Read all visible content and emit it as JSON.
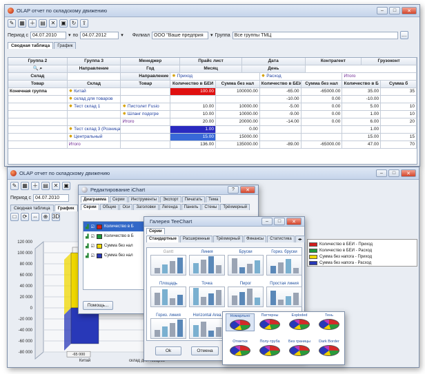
{
  "back_window": {
    "title": "OLAP отчет по складскому движению",
    "filter": {
      "period_from_label": "Период с",
      "period_from": "04.07.2010",
      "period_to_label": "по",
      "period_to": "04.07.2012",
      "branch_label": "Филиал",
      "branch_value": "ООО \"Ваше предприя",
      "group_label": "Группа",
      "group_value": "Все группы ТМЦ"
    },
    "tabs": [
      "Сводная таблица",
      "График"
    ],
    "header_fields": [
      "Группа 2",
      "Группа 3",
      "Менеджер",
      "Прайс лист",
      "Дата",
      "Контрагент",
      "Грузоконт"
    ],
    "header_fields2": [
      "Направление",
      "Год",
      "Месяц",
      "День"
    ],
    "row_fields": [
      "Склад",
      "Товар"
    ],
    "direction_label": "Направление",
    "warehouse_label": "Склад",
    "product_label": "Товар",
    "col_groups": [
      "Приход",
      "Расход",
      "Итого"
    ],
    "measures": [
      "Количество в БЕИ",
      "Сумма без нал",
      "Количество в БЕИ",
      "Сумма без нал",
      "Количество в Б",
      "Сумма б"
    ],
    "group_label_total": "Конечная группа",
    "rows": [
      {
        "wh": "Китай",
        "prod": "",
        "v": [
          "100.00",
          "100000.00",
          "-65.00",
          "-65000.00",
          "35.00",
          "35"
        ]
      },
      {
        "wh": "склад для товаров",
        "prod": "",
        "v": [
          "",
          "",
          "-10.00",
          "0.00",
          "-10.00",
          ""
        ]
      },
      {
        "wh": "Тест склад 1",
        "prod": "Пистолет Fusio",
        "v": [
          "10.00",
          "10000.00",
          "-5.00",
          "0.00",
          "5.00",
          "10"
        ]
      },
      {
        "wh": "",
        "prod": "Шланг подогре",
        "v": [
          "10.00",
          "10000.00",
          "-9.00",
          "0.00",
          "1.00",
          "10"
        ]
      },
      {
        "wh": "",
        "prod": "Итого",
        "v": [
          "20.00",
          "20000.00",
          "-14.00",
          "0.00",
          "6.00",
          "20"
        ]
      },
      {
        "wh": "Тест склад 3 (Розница)",
        "prod": "",
        "v": [
          "1.00",
          "0.00",
          "",
          "",
          "1.00",
          ""
        ]
      },
      {
        "wh": "Центральный",
        "prod": "",
        "v": [
          "15.00",
          "15000.00",
          "",
          "",
          "15.00",
          "15"
        ]
      },
      {
        "wh": "Итого",
        "prod": "",
        "v": [
          "136.00",
          "135000.00",
          "-89.00",
          "-65000.00",
          "47.00",
          "70"
        ]
      }
    ]
  },
  "front_window": {
    "title": "OLAP отчет по складскому движению",
    "period_label": "Период с",
    "period_value": "04.07.2010",
    "tabs": [
      "Сводная таблица",
      "График"
    ],
    "y_ticks": [
      "120 000",
      "100 000",
      "80 000",
      "60 000",
      "40 000",
      "20 000",
      "0",
      "-20 000",
      "-40 000",
      "-60 000",
      "-80 000"
    ],
    "value_top": "100 000",
    "value_bottom": "-65 000",
    "x_labels": [
      "Китай",
      "склад для товаров"
    ]
  },
  "chart_data": {
    "type": "bar",
    "categories": [
      "Китай",
      "склад для товаров"
    ],
    "series": [
      {
        "name": "Количество в БЕИ - Приход",
        "values": [
          100,
          0
        ]
      },
      {
        "name": "Количество в БЕИ - Расход",
        "values": [
          -65,
          -10
        ]
      },
      {
        "name": "Сумма без напога - Приход",
        "values": [
          100000,
          0
        ]
      },
      {
        "name": "Сумма без напога - Расход",
        "values": [
          -65000,
          0
        ]
      }
    ],
    "ylim": [
      -80000,
      120000
    ],
    "colors": [
      "#d41c1c",
      "#1e9a3c",
      "#f0d800",
      "#2838b8"
    ]
  },
  "legend": [
    "Количество в БЕИ - Приход",
    "Количество в БЕИ - Расход",
    "Сумма без напога - Приход",
    "Сумма без напога - Расход"
  ],
  "editor": {
    "title": "Редактирование iChart",
    "tabs": [
      "Диаграмма",
      "Серии",
      "Инструменты",
      "Экспорт",
      "Печатать",
      "Тема"
    ],
    "subtabs": [
      "Серии",
      "Общие",
      "Оси",
      "Заголовки",
      "Легенда",
      "Панель",
      "Стены",
      "Трёхмерный"
    ],
    "series_items": [
      "Количество в Б",
      "Количество в Б",
      "Сумма без нал",
      "Сумма без нал"
    ],
    "help_button": "Помощь..."
  },
  "gallery": {
    "title": "Галерея TeeChart",
    "tab_series": "Серии",
    "tabs": [
      "Стандартные",
      "Расширенные",
      "Трёхмерный",
      "Финансы",
      "Статистика"
    ],
    "charts": [
      "Gantt",
      "Линия",
      "Бруски",
      "Гориз. бруски",
      "Площадь",
      "Точка",
      "Пирог",
      "Простая линия",
      "Гориз. линия",
      "Horizontal Area"
    ],
    "ok_button": "Ok",
    "cancel_button": "Отмена"
  },
  "pie_gallery": {
    "items": [
      "Номарльно",
      "Паттерны",
      "Exploded",
      "Тень",
      "Отметки",
      "Полу-труба",
      "Без границы",
      "Dark Border"
    ]
  }
}
